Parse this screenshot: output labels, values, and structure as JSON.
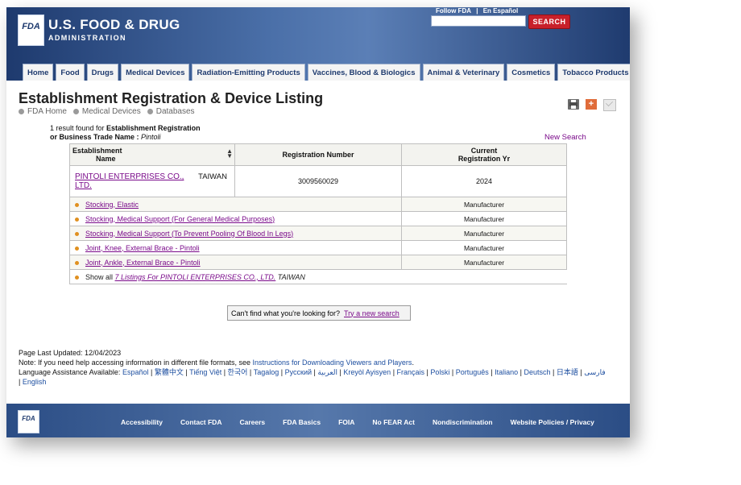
{
  "header": {
    "logo_text": "FDA",
    "brand_line1": "U.S. FOOD & DRUG",
    "brand_line2": "ADMINISTRATION",
    "top_links": [
      "Follow FDA",
      "|",
      "En Español"
    ],
    "search": {
      "placeholder": "",
      "button": "SEARCH"
    },
    "colors": {
      "header_bg": "#1e3a6e",
      "search_button": "#c8202a"
    }
  },
  "nav": {
    "tabs": [
      "Home",
      "Food",
      "Drugs",
      "Medical Devices",
      "Radiation-Emitting Products",
      "Vaccines, Blood & Biologics",
      "Animal & Veterinary",
      "Cosmetics",
      "Tobacco Products"
    ]
  },
  "page": {
    "title": "Establishment Registration & Device Listing",
    "breadcrumb": [
      "FDA Home",
      "Medical Devices",
      "Databases"
    ],
    "tools": [
      "print-icon",
      "add-icon",
      "email-icon"
    ]
  },
  "results": {
    "count_line": "1 result found for ",
    "count_bold": "Establishment Registration",
    "line2_bold": "or Business Trade Name : ",
    "query": "Pintoli",
    "new_search": "New Search",
    "headers": {
      "name": "Establishment\nName",
      "name_line1": "Establishment",
      "name_line2": "Name",
      "registration": "Registration Number",
      "year_line1": "Current",
      "year_line2": "Registration Yr"
    },
    "establishment": {
      "name_line1": "PINTOLI ENTERPRISES CO.,",
      "name_line2": "LTD.",
      "country": "TAIWAN",
      "registration_number": "3009560029",
      "year": "2024"
    },
    "listings": [
      {
        "name": "Stocking, Elastic",
        "type": "Manufacturer"
      },
      {
        "name": "Stocking, Medical Support (For General Medical Purposes)",
        "type": "Manufacturer"
      },
      {
        "name": "Stocking, Medical Support (To Prevent Pooling Of Blood In Legs)",
        "type": "Manufacturer"
      },
      {
        "name": "Joint, Knee, External Brace - Pintoli",
        "type": "Manufacturer"
      },
      {
        "name": "Joint, Ankle, External Brace - Pintoli",
        "type": "Manufacturer"
      }
    ],
    "show_all": {
      "prefix": "Show all ",
      "link": "7 Listings For PINTOLI ENTERPRISES CO., LTD.",
      "suffix": " TAIWAN"
    }
  },
  "cant_find": {
    "text": "Can't find what you're looking for?",
    "link": "Try a new search"
  },
  "footer": {
    "updated": "Page Last Updated: 12/04/2023",
    "note_prefix": "Note: If you need help accessing information in different file formats, see ",
    "note_link": "Instructions for Downloading Viewers and Players",
    "note_suffix": ".",
    "lang_prefix": "Language Assistance Available: ",
    "languages": [
      "Español",
      "繁體中文",
      "Tiếng Việt",
      "한국어",
      "Tagalog",
      "Русский",
      "العربية",
      "Kreyòl Ayisyen",
      "Français",
      "Polski",
      "Português",
      "Italiano",
      "Deutsch",
      "日本語",
      "فارسی",
      "English"
    ]
  },
  "bottom_bar": {
    "logo_text": "FDA",
    "links": [
      "Accessibility",
      "Contact FDA",
      "Careers",
      "FDA Basics",
      "FOIA",
      "No FEAR Act",
      "Nondiscrimination",
      "Website Policies / Privacy"
    ]
  }
}
